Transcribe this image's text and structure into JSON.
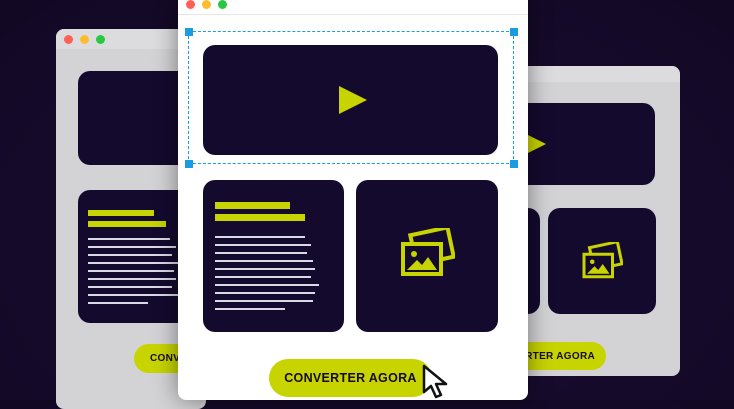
{
  "colors": {
    "background": "#160a2b",
    "accent": "#c8d400",
    "card": "#140a2e",
    "window_front": "#ffffff",
    "window_back": "#d3d3d6",
    "selection": "#1b9be0",
    "traffic_red": "#ff5f57",
    "traffic_yellow": "#febc2e",
    "traffic_green": "#28c840"
  },
  "icons": [
    "play-icon",
    "image-gallery-icon",
    "cursor-icon"
  ],
  "front_window": {
    "cta_label": "CONVERTER AGORA",
    "video_selected": true
  },
  "back_left_window": {
    "cta_label": "CONVERTER AGORA"
  },
  "back_right_window": {
    "cta_label": "CONVERTER AGORA"
  }
}
